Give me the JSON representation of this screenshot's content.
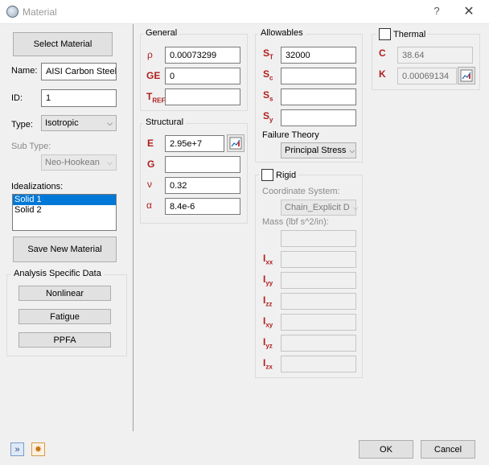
{
  "window": {
    "title": "Material",
    "help": "?",
    "close": "✕"
  },
  "left": {
    "select_material": "Select Material",
    "name_label": "Name:",
    "name_value": "AISI Carbon Steel :",
    "id_label": "ID:",
    "id_value": "1",
    "type_label": "Type:",
    "type_value": "Isotropic",
    "subtype_label": "Sub Type:",
    "subtype_value": "Neo-Hookean",
    "idealizations_label": "Idealizations:",
    "idealizations": [
      "Solid 1",
      "Solid 2"
    ],
    "save_new": "Save New Material",
    "analysis_title": "Analysis Specific Data",
    "nonlinear": "Nonlinear",
    "fatigue": "Fatigue",
    "ppfa": "PPFA"
  },
  "general": {
    "title": "General",
    "rho_sym": "ρ",
    "rho_value": "0.00073299",
    "ge_sym": "GE",
    "ge_value": "0",
    "tref_sym": "T",
    "tref_sub": "REF",
    "tref_value": ""
  },
  "structural": {
    "title": "Structural",
    "e_sym": "E",
    "e_value": "2.95e+7",
    "g_sym": "G",
    "g_value": "",
    "nu_sym": "ν",
    "nu_value": "0.32",
    "alpha_sym": "α",
    "alpha_value": "8.4e-6"
  },
  "allowables": {
    "title": "Allowables",
    "st_sym": "S",
    "st_sub": "T",
    "st_value": "32000",
    "sc_sym": "S",
    "sc_sub": "c",
    "sc_value": "",
    "ss_sym": "S",
    "ss_sub": "s",
    "ss_value": "",
    "sy_sym": "S",
    "sy_sub": "y",
    "sy_value": "",
    "failure_label": "Failure Theory",
    "failure_value": "Principal Stress"
  },
  "rigid": {
    "title": "Rigid",
    "coord_label": "Coordinate System:",
    "coord_value": "Chain_Explicit D",
    "mass_label": "Mass (lbf s^2/in):",
    "mass_value": "",
    "inertia": [
      {
        "sym": "I",
        "sub": "xx"
      },
      {
        "sym": "I",
        "sub": "yy"
      },
      {
        "sym": "I",
        "sub": "zz"
      },
      {
        "sym": "I",
        "sub": "xy"
      },
      {
        "sym": "I",
        "sub": "yz"
      },
      {
        "sym": "I",
        "sub": "zx"
      }
    ]
  },
  "thermal": {
    "title": "Thermal",
    "c_sym": "C",
    "c_value": "38.64",
    "k_sym": "K",
    "k_value": "0.00069134"
  },
  "footer": {
    "ok": "OK",
    "cancel": "Cancel"
  },
  "colors": {
    "symbol": "#b01e1e",
    "selection": "#0078d7"
  }
}
